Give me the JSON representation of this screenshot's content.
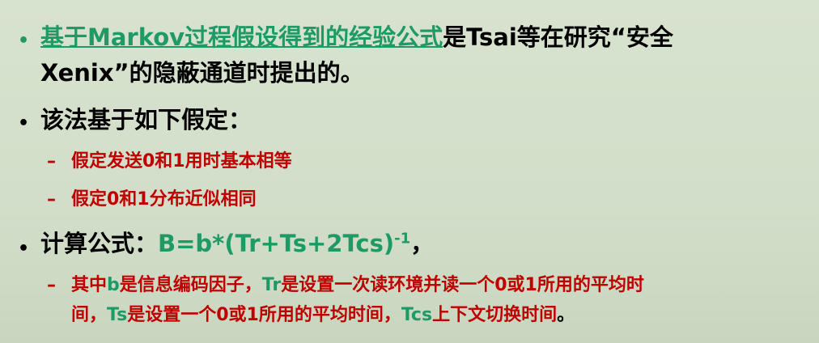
{
  "slide": {
    "bullet1": {
      "link_text": "基于Markov过程假设得到的经验公式",
      "rest_line1": "是Tsai等在研究“安全",
      "line2": "Xenix”的隐蔽通道时提出的。"
    },
    "bullet2": {
      "text": "该法基于如下假定：",
      "subitems": [
        "假定发送0和1用时基本相等",
        "假定0和1分布近似相同"
      ]
    },
    "bullet3": {
      "label": "计算公式：",
      "formula": "B=b*(Tr+Ts+2Tcs)",
      "exponent": "-1",
      "trail": "，",
      "sub": {
        "p1": "其中",
        "v_b": "b",
        "p2": "是信息编码因子，",
        "v_tr": "Tr",
        "p3": "是设置一次读环境并读一个0或1所用的平均时",
        "p4": "间，",
        "v_ts": "Ts",
        "p5": "是设置一个0或1所用的平均时间，",
        "v_tcs": "Tcs",
        "p6": "上下文切换时间",
        "p7": "。"
      }
    },
    "colors": {
      "accent_green": "#1e9a66",
      "accent_red": "#c00000",
      "background": "#d5e0cc"
    }
  }
}
